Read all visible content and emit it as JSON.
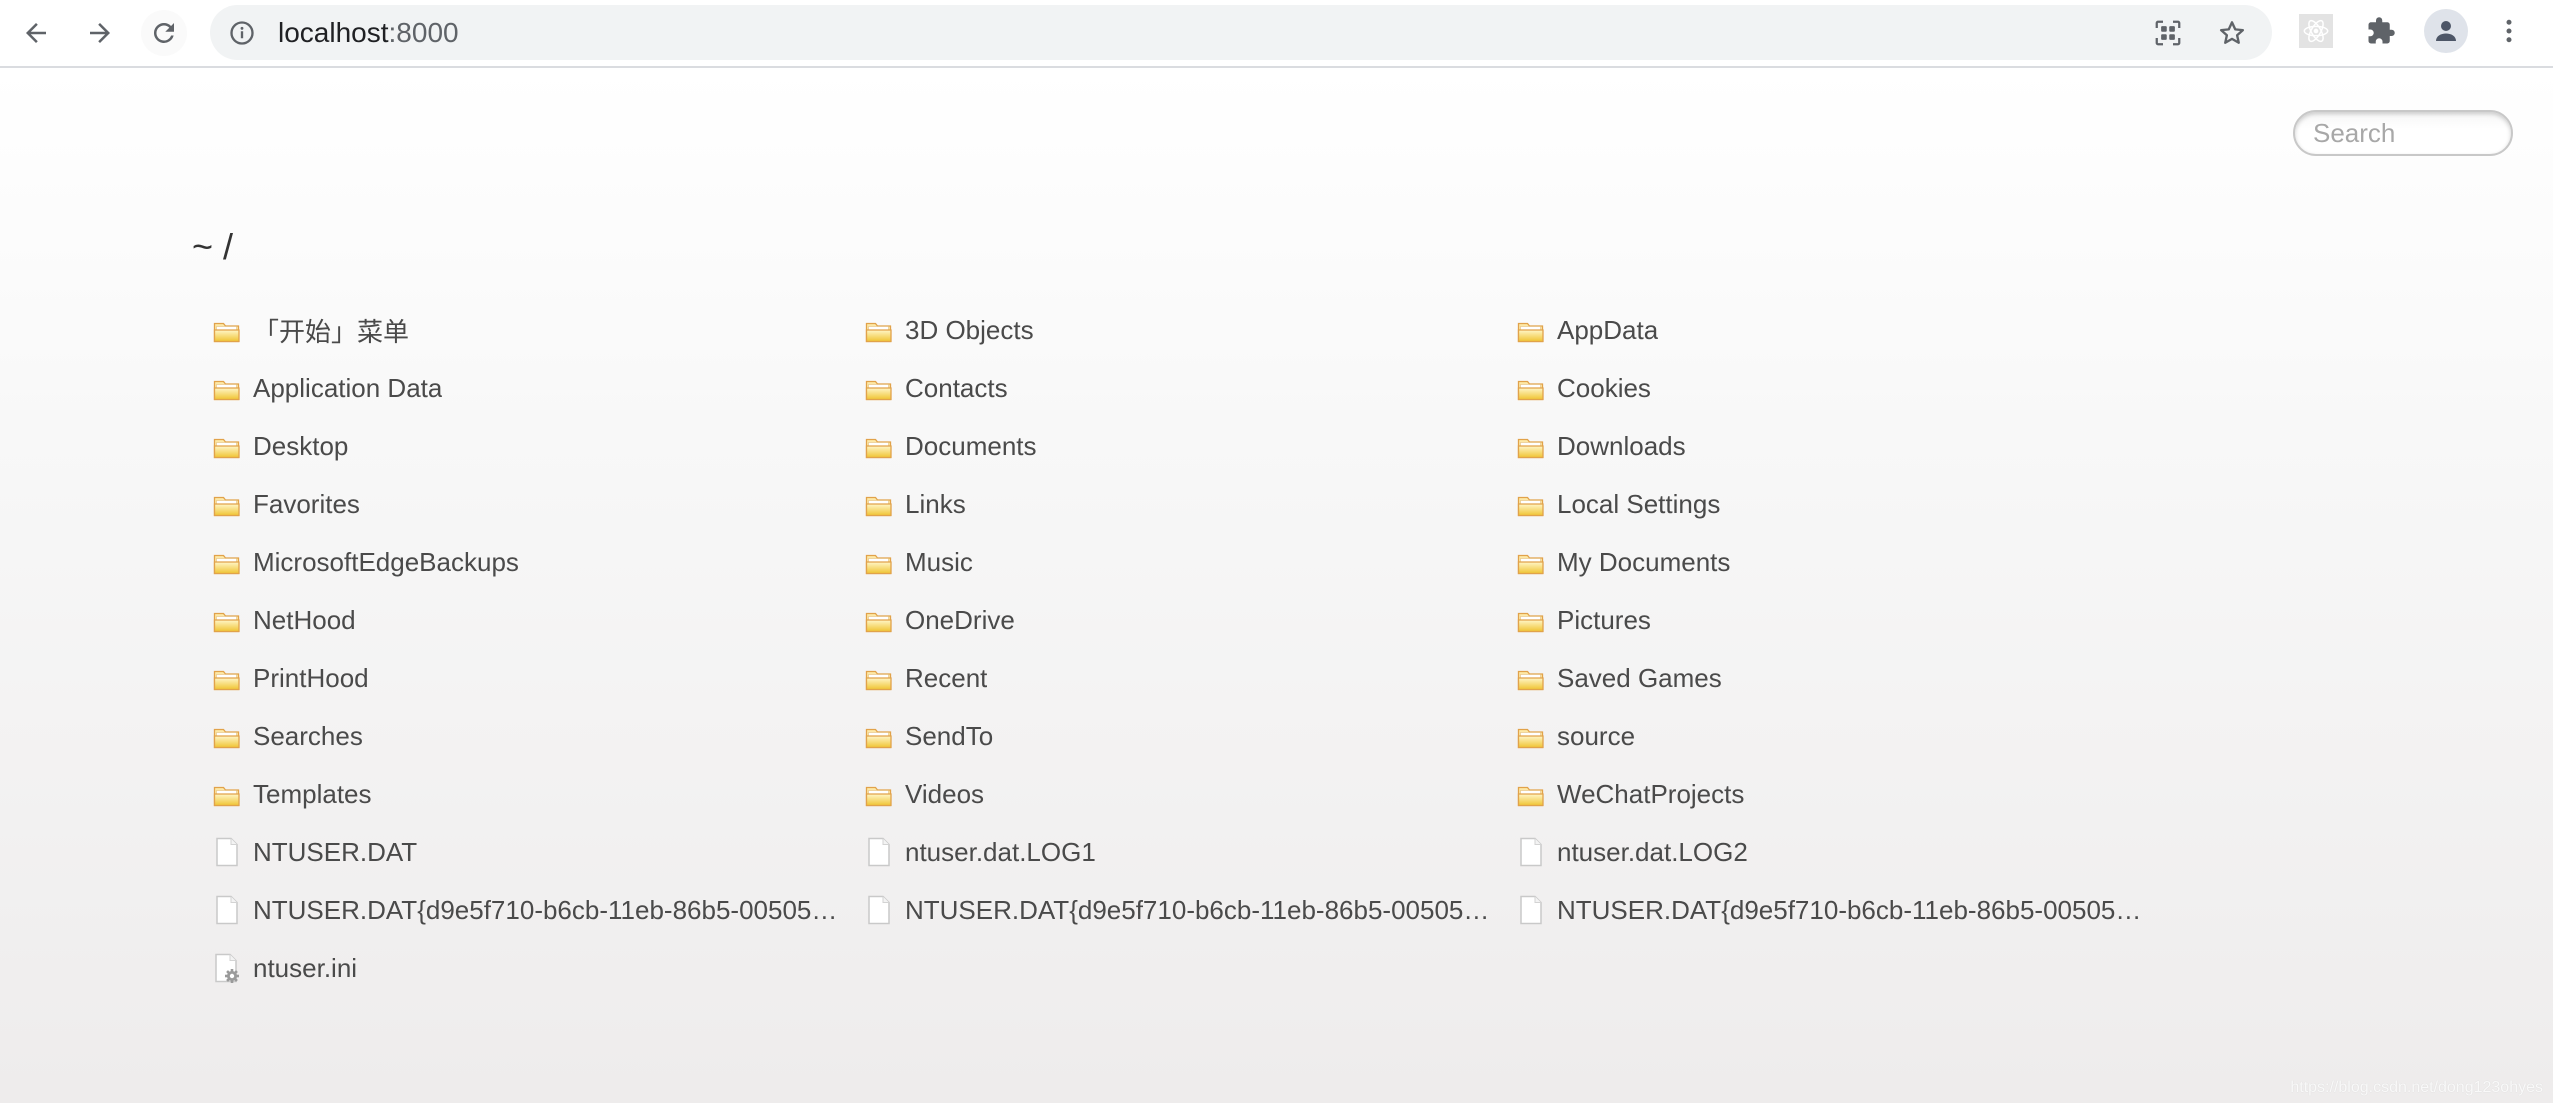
{
  "browser": {
    "url_host": "localhost",
    "url_port": ":8000",
    "icons": {
      "back": "arrow-left-icon",
      "forward": "arrow-right-icon",
      "reload": "reload-icon",
      "site_info": "info-icon",
      "qr": "qr-code-icon",
      "bookmark": "star-icon",
      "react_devtools": "react-atom-icon",
      "extensions": "puzzle-icon",
      "profile": "person-icon",
      "menu": "kebab-menu-icon"
    }
  },
  "page": {
    "search_placeholder": "Search",
    "search_value": "",
    "breadcrumb": "~ /",
    "folder_icon_color": "#f4c542",
    "files": [
      {
        "name": "「开始」菜单",
        "type": "folder"
      },
      {
        "name": "3D Objects",
        "type": "folder"
      },
      {
        "name": "AppData",
        "type": "folder"
      },
      {
        "name": "Application Data",
        "type": "folder"
      },
      {
        "name": "Contacts",
        "type": "folder"
      },
      {
        "name": "Cookies",
        "type": "folder"
      },
      {
        "name": "Desktop",
        "type": "folder"
      },
      {
        "name": "Documents",
        "type": "folder"
      },
      {
        "name": "Downloads",
        "type": "folder"
      },
      {
        "name": "Favorites",
        "type": "folder"
      },
      {
        "name": "Links",
        "type": "folder"
      },
      {
        "name": "Local Settings",
        "type": "folder"
      },
      {
        "name": "MicrosoftEdgeBackups",
        "type": "folder"
      },
      {
        "name": "Music",
        "type": "folder"
      },
      {
        "name": "My Documents",
        "type": "folder"
      },
      {
        "name": "NetHood",
        "type": "folder"
      },
      {
        "name": "OneDrive",
        "type": "folder"
      },
      {
        "name": "Pictures",
        "type": "folder"
      },
      {
        "name": "PrintHood",
        "type": "folder"
      },
      {
        "name": "Recent",
        "type": "folder"
      },
      {
        "name": "Saved Games",
        "type": "folder"
      },
      {
        "name": "Searches",
        "type": "folder"
      },
      {
        "name": "SendTo",
        "type": "folder"
      },
      {
        "name": "source",
        "type": "folder"
      },
      {
        "name": "Templates",
        "type": "folder"
      },
      {
        "name": "Videos",
        "type": "folder"
      },
      {
        "name": "WeChatProjects",
        "type": "folder"
      },
      {
        "name": "NTUSER.DAT",
        "type": "file"
      },
      {
        "name": "ntuser.dat.LOG1",
        "type": "file"
      },
      {
        "name": "ntuser.dat.LOG2",
        "type": "file"
      },
      {
        "name": "NTUSER.DAT{d9e5f710-b6cb-11eb-86b5-00505…",
        "type": "file"
      },
      {
        "name": "NTUSER.DAT{d9e5f710-b6cb-11eb-86b5-00505…",
        "type": "file"
      },
      {
        "name": "NTUSER.DAT{d9e5f710-b6cb-11eb-86b5-00505…",
        "type": "file"
      },
      {
        "name": "ntuser.ini",
        "type": "settings-file"
      }
    ]
  },
  "watermark": "https://blog.csdn.net/dong123ohyes"
}
